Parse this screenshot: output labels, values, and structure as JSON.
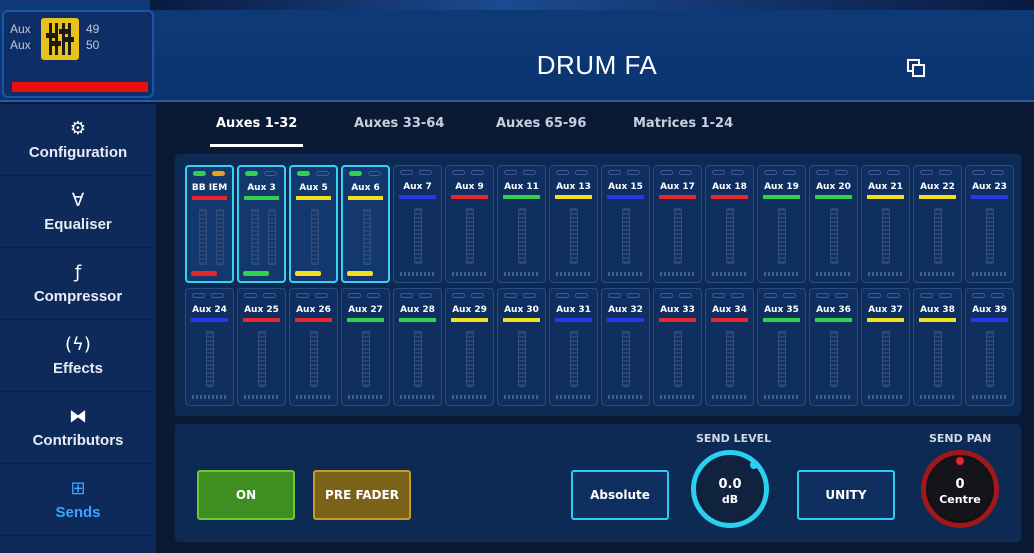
{
  "header": {
    "aux_label_top": "Aux",
    "aux_label_bottom": "Aux",
    "num_top": "49",
    "num_bottom": "50",
    "title": "DRUM FA",
    "copy_icon": "copy-window-icon"
  },
  "sidebar": {
    "items": [
      {
        "label": "Configuration",
        "icon": "config-icon",
        "glyph": "⚙"
      },
      {
        "label": "Equaliser",
        "icon": "eq-icon",
        "glyph": "∀"
      },
      {
        "label": "Compressor",
        "icon": "compressor-icon",
        "glyph": "ƒ"
      },
      {
        "label": "Effects",
        "icon": "effects-icon",
        "glyph": "(ϟ)"
      },
      {
        "label": "Contributors",
        "icon": "contributors-icon",
        "glyph": "⧓"
      },
      {
        "label": "Sends",
        "icon": "sends-icon",
        "glyph": "⊞",
        "active": true
      }
    ]
  },
  "tabs": [
    {
      "label": "Auxes 1-32",
      "active": true
    },
    {
      "label": "Auxes 33-64"
    },
    {
      "label": "Auxes 65-96"
    },
    {
      "label": "Matrices 1-24"
    }
  ],
  "strips_row1": [
    {
      "name": "BB IEM",
      "color": "#e8262e",
      "selected": true,
      "fill": "#e8262e",
      "stereo": true
    },
    {
      "name": "Aux 3",
      "color": "#2fd24a",
      "selected": true,
      "fill": "#2fd24a",
      "stereo": true
    },
    {
      "name": "Aux 5",
      "color": "#f0e020",
      "selected": true,
      "fill": "#f0e020"
    },
    {
      "name": "Aux 6",
      "color": "#f0e020",
      "selected": true,
      "fill": "#f0e020"
    },
    {
      "name": "Aux 7",
      "color": "#2a36e8"
    },
    {
      "name": "Aux 9",
      "color": "#e8262e"
    },
    {
      "name": "Aux 11",
      "color": "#2fd24a"
    },
    {
      "name": "Aux 13",
      "color": "#f0e020"
    },
    {
      "name": "Aux 15",
      "color": "#2a36e8"
    },
    {
      "name": "Aux 17",
      "color": "#e8262e"
    },
    {
      "name": "Aux 18",
      "color": "#e8262e"
    },
    {
      "name": "Aux 19",
      "color": "#2fd24a"
    },
    {
      "name": "Aux 20",
      "color": "#2fd24a"
    },
    {
      "name": "Aux 21",
      "color": "#f0e020"
    },
    {
      "name": "Aux 22",
      "color": "#f0e020"
    },
    {
      "name": "Aux 23",
      "color": "#2a36e8"
    }
  ],
  "strips_row2": [
    {
      "name": "Aux 24",
      "color": "#2a36e8"
    },
    {
      "name": "Aux 25",
      "color": "#e8262e"
    },
    {
      "name": "Aux 26",
      "color": "#e8262e"
    },
    {
      "name": "Aux 27",
      "color": "#2fd24a"
    },
    {
      "name": "Aux 28",
      "color": "#2fd24a"
    },
    {
      "name": "Aux 29",
      "color": "#f0e020"
    },
    {
      "name": "Aux 30",
      "color": "#f0e020"
    },
    {
      "name": "Aux 31",
      "color": "#2a36e8"
    },
    {
      "name": "Aux 32",
      "color": "#2a36e8"
    },
    {
      "name": "Aux 33",
      "color": "#e8262e"
    },
    {
      "name": "Aux 34",
      "color": "#e8262e"
    },
    {
      "name": "Aux 35",
      "color": "#2fd24a"
    },
    {
      "name": "Aux 36",
      "color": "#2fd24a"
    },
    {
      "name": "Aux 37",
      "color": "#f0e020"
    },
    {
      "name": "Aux 38",
      "color": "#f0e020"
    },
    {
      "name": "Aux 39",
      "color": "#2a36e8"
    }
  ],
  "controls": {
    "on_label": "ON",
    "pre_fader_label": "PRE FADER",
    "absolute_label": "Absolute",
    "send_level_title": "SEND LEVEL",
    "send_level_value": "0.0",
    "send_level_unit": "dB",
    "unity_label": "UNITY",
    "send_pan_title": "SEND PAN",
    "send_pan_value": "0",
    "send_pan_unit": "Centre"
  }
}
